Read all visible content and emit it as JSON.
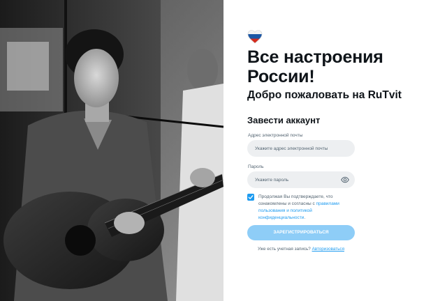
{
  "photo": {
    "icon": "guitarist-photo",
    "style": "black-and-white"
  },
  "logo": {
    "icon": "russia-flag-heart-icon",
    "colors": [
      "#ffffff",
      "#1c57a5",
      "#d52b1e"
    ]
  },
  "headline": {
    "line1": "Все настроения",
    "line2": "России!"
  },
  "welcome": "Добро пожаловать на RuTvit",
  "create_account": "Завести аккаунт",
  "form": {
    "email_label": "Адрес электронной почты",
    "email_placeholder": "Укажите адрес электронной почты",
    "password_label": "Пароль",
    "password_placeholder": "Укажите пароль",
    "eye_icon": "eye-icon"
  },
  "terms": {
    "checked": true,
    "text": "Продолжая Вы подтверждаете, что ознакомлены и согласны с ",
    "link": "правилами пользования и политикой конфиденциальности",
    "end": "."
  },
  "register_button": "ЗАРЕГИСТРИРОВАТЬСЯ",
  "login": {
    "text": "Уже есть учетная запись? ",
    "link": "Авторизоваться"
  },
  "colors": {
    "accent": "#1d9bf0",
    "button": "#8ecdf7",
    "field": "#edeff1"
  }
}
